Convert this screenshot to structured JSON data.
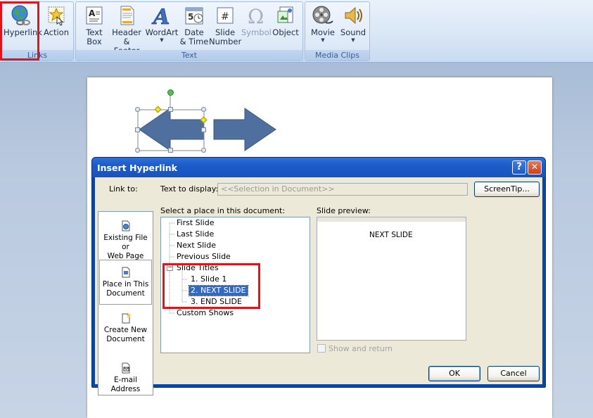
{
  "ribbon": {
    "groups": {
      "links": "Links",
      "text": "Text",
      "media_clips": "Media Clips"
    },
    "buttons": {
      "hyperlink": "Hyperlink",
      "action": "Action",
      "text_box_1": "Text",
      "text_box_2": "Box",
      "header_footer_1": "Header",
      "header_footer_2": "& Footer",
      "wordart": "WordArt",
      "date_time_1": "Date",
      "date_time_2": "& Time",
      "slide_number_1": "Slide",
      "slide_number_2": "Number",
      "symbol": "Symbol",
      "object": "Object",
      "movie": "Movie",
      "sound": "Sound"
    },
    "icons": {
      "hyperlink": "globe-chain-icon",
      "action": "star-hand-icon",
      "text_box": "text-box-icon",
      "header_footer": "page-icon",
      "wordart": "wordart-a-icon",
      "date_time": "calendar-icon",
      "slide_number": "number-sign-icon",
      "symbol": "omega-icon",
      "object": "object-icon",
      "movie": "film-reel-icon",
      "sound": "speaker-icon"
    },
    "date_icon_number": "5",
    "symbol_glyph": "Ω",
    "wordart_glyph": "A"
  },
  "dialog": {
    "title": "Insert Hyperlink",
    "help_glyph": "?",
    "close_glyph": "✕",
    "link_to_label": "Link to:",
    "text_to_display_label": "Text to display:",
    "text_to_display_value": "<<Selection in Document>>",
    "screentip_label": "ScreenTip...",
    "places": [
      {
        "line1": "Existing File or",
        "line2": "Web Page"
      },
      {
        "line1": "Place in This",
        "line2": "Document"
      },
      {
        "line1": "Create New",
        "line2": "Document"
      },
      {
        "line1": "E-mail Address",
        "line2": ""
      }
    ],
    "select_place_label": "Select a place in this document:",
    "tree": {
      "first_slide": "First Slide",
      "last_slide": "Last Slide",
      "next_slide": "Next Slide",
      "previous_slide": "Previous Slide",
      "slide_titles": "Slide Titles",
      "expander_glyph": "−",
      "slides": [
        "1. Slide 1",
        "2. NEXT SLIDE",
        "3. END SLIDE"
      ],
      "custom_shows": "Custom Shows"
    },
    "slide_preview_label": "Slide preview:",
    "preview_text": "NEXT SLIDE",
    "show_and_return": "Show and return",
    "ok_label": "OK",
    "cancel_label": "Cancel"
  },
  "colors": {
    "highlight_red": "#e0151b",
    "selection_blue": "#316ac5",
    "arrow_fill": "#4f6f9f",
    "title_bar": "#1d5cc8"
  }
}
